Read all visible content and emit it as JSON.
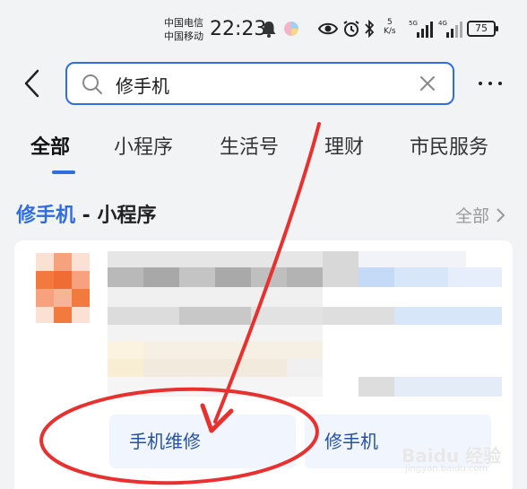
{
  "status_bar": {
    "carrier_1": "中国电信",
    "carrier_2": "中国移动",
    "time": "22:23",
    "net_speed_value": "5",
    "net_speed_unit": "K/s",
    "sim1_label": "5G",
    "sim2_label": "4G",
    "battery": "75"
  },
  "search": {
    "query": "修手机"
  },
  "tabs": [
    {
      "label": "全部",
      "active": true
    },
    {
      "label": "小程序",
      "active": false
    },
    {
      "label": "生活号",
      "active": false
    },
    {
      "label": "理财",
      "active": false
    },
    {
      "label": "市民服务",
      "active": false
    }
  ],
  "section": {
    "title_keyword": "修手机",
    "title_suffix": " - 小程序",
    "view_all": "全部"
  },
  "result_card": {
    "services": [
      "手机维修",
      "修手机"
    ]
  },
  "watermark": {
    "brand": "Baidu 经验",
    "url": "jingyan.baidu.com"
  },
  "colors": {
    "accent": "#2f6de0",
    "annotation": "#e8312f"
  }
}
